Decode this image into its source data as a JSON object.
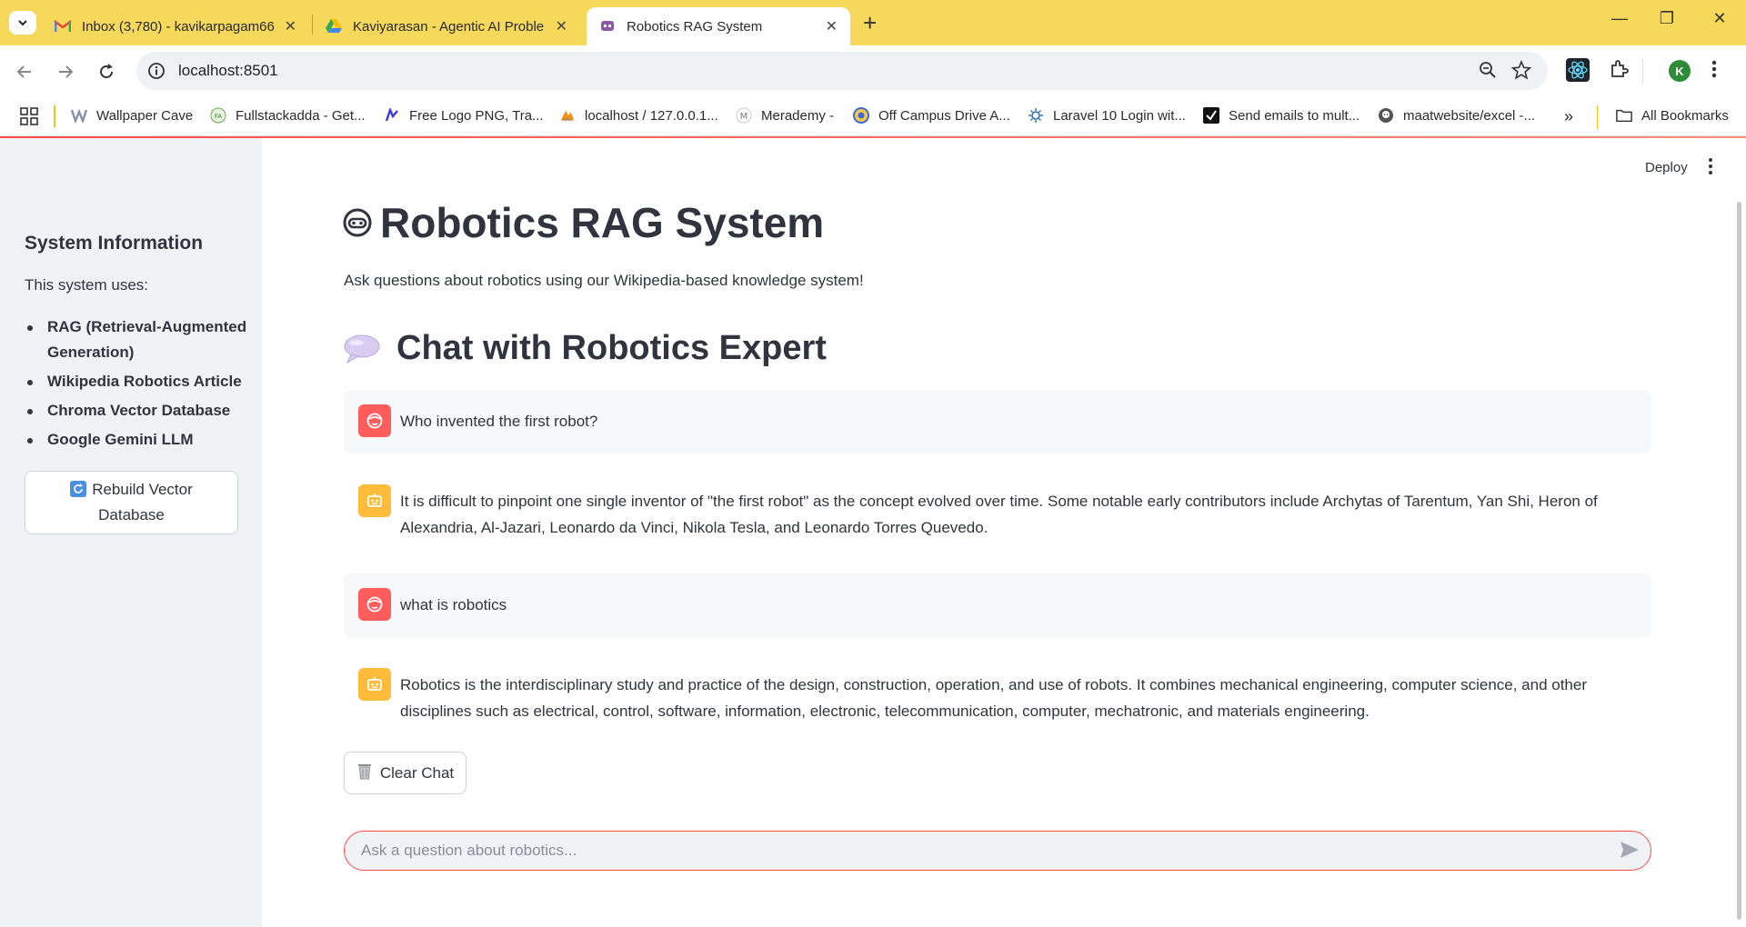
{
  "browser": {
    "tabs": [
      {
        "title": "Inbox (3,780) - kavikarpagam66",
        "icon": "gmail-icon",
        "active": false
      },
      {
        "title": "Kaviyarasan - Agentic AI Proble",
        "icon": "google-drive-icon",
        "active": false
      },
      {
        "title": "Robotics RAG System",
        "icon": "streamlit-icon",
        "active": true
      }
    ],
    "url": "localhost:8501",
    "profile_initial": "K",
    "bookmarks": [
      {
        "label": "Wallpaper Cave",
        "icon": "wallpaper-cave-icon"
      },
      {
        "label": "Fullstackadda - Get...",
        "icon": "fullstackadda-icon"
      },
      {
        "label": "Free Logo PNG, Tra...",
        "icon": "logo-png-icon"
      },
      {
        "label": "localhost / 127.0.0.1...",
        "icon": "phpmyadmin-icon"
      },
      {
        "label": "Merademy -",
        "icon": "merademy-icon"
      },
      {
        "label": "Off Campus Drive A...",
        "icon": "off-campus-icon"
      },
      {
        "label": "Laravel 10 Login wit...",
        "icon": "laravel-icon"
      },
      {
        "label": "Send emails to mult...",
        "icon": "email-icon"
      },
      {
        "label": "maatwebsite/excel -...",
        "icon": "github-icon"
      }
    ],
    "all_bookmarks_label": "All Bookmarks"
  },
  "app": {
    "deploy_label": "Deploy",
    "sidebar": {
      "title": "System Information",
      "intro": "This system uses:",
      "items": [
        "RAG (Retrieval-Augmented Generation)",
        "Wikipedia Robotics Article",
        "Chroma Vector Database",
        "Google Gemini LLM"
      ],
      "rebuild_button": "Rebuild Vector Database"
    },
    "title": "Robotics RAG System",
    "subtitle": "Ask questions about robotics using our Wikipedia-based knowledge system!",
    "chat_header": "Chat with Robotics Expert",
    "messages": [
      {
        "role": "user",
        "text": "Who invented the first robot?"
      },
      {
        "role": "assistant",
        "text": "It is difficult to pinpoint one single inventor of \"the first robot\" as the concept evolved over time. Some notable early contributors include Archytas of Tarentum, Yan Shi, Heron of Alexandria, Al-Jazari, Leonardo da Vinci, Nikola Tesla, and Leonardo Torres Quevedo."
      },
      {
        "role": "user",
        "text": "what is robotics"
      },
      {
        "role": "assistant",
        "text": "Robotics is the interdisciplinary study and practice of the design, construction, operation, and use of robots. It combines mechanical engineering, computer science, and other disciplines such as electrical, control, software, information, electronic, telecommunication, computer, mechatronic, and materials engineering."
      }
    ],
    "clear_button": "Clear Chat",
    "chat_input": {
      "value": "",
      "placeholder": "Ask a question about robotics..."
    }
  },
  "colors": {
    "accent": "#ff4b4b",
    "tabstrip": "#f6d85a",
    "user_avatar": "#ff5c5c",
    "assistant_avatar": "#ffbc3b",
    "sidebar_bg": "#f0f2f6"
  }
}
